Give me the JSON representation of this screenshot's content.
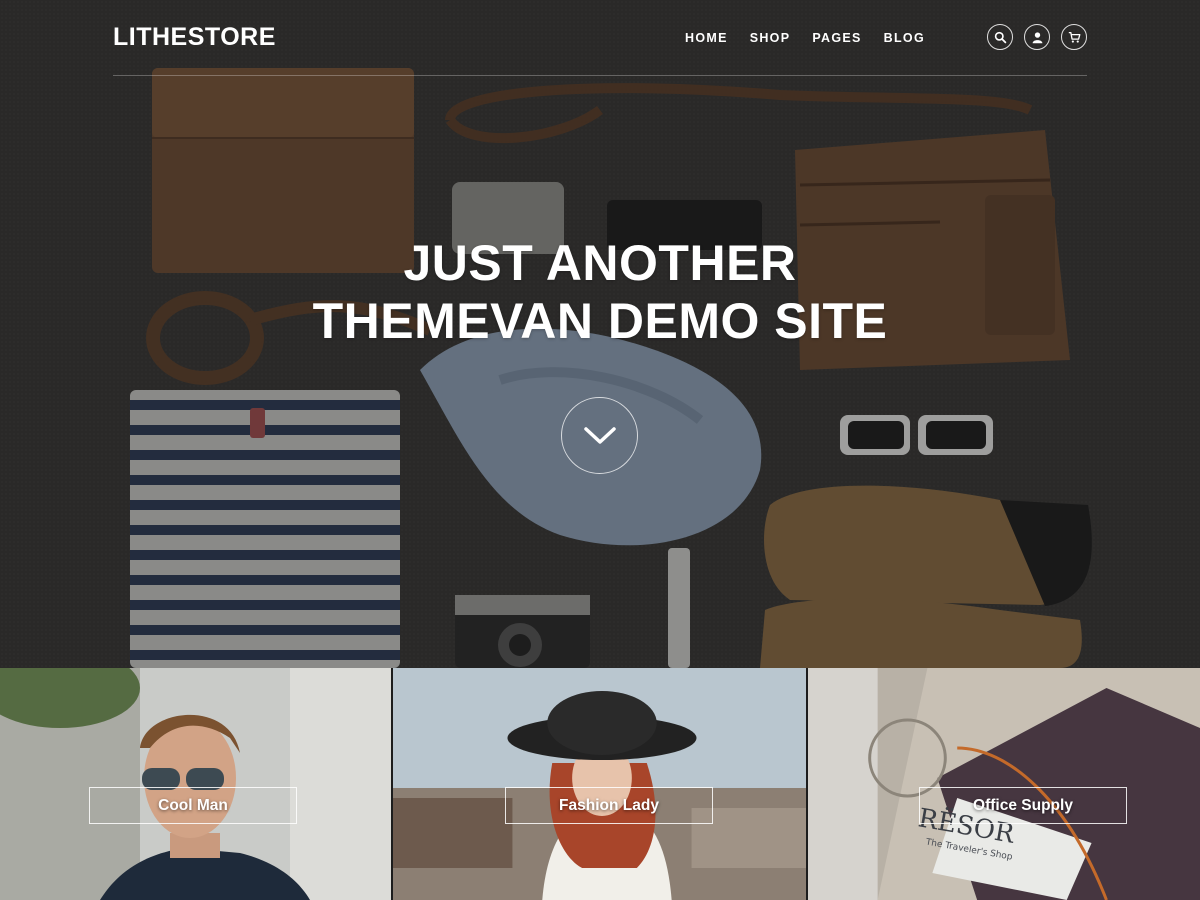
{
  "site": {
    "logo": "LITHESTORE"
  },
  "nav": {
    "items": [
      {
        "label": "HOME"
      },
      {
        "label": "SHOP"
      },
      {
        "label": "PAGES"
      },
      {
        "label": "BLOG"
      }
    ],
    "icons": [
      "search-icon",
      "user-icon",
      "cart-icon"
    ]
  },
  "hero": {
    "title_line1": "JUST ANOTHER",
    "title_line2": "THEMEVAN DEMO SITE",
    "scroll_icon": "chevron-down-icon"
  },
  "categories": [
    {
      "label": "Cool Man"
    },
    {
      "label": "Fashion Lady"
    },
    {
      "label": "Office Supply"
    }
  ],
  "decor": {
    "notebook_text": "RËSOR",
    "notebook_subtext": "The Traveler's Shop"
  },
  "colors": {
    "text": "#ffffff",
    "hero_bg": "#363534",
    "leather": "#6b4a32"
  }
}
